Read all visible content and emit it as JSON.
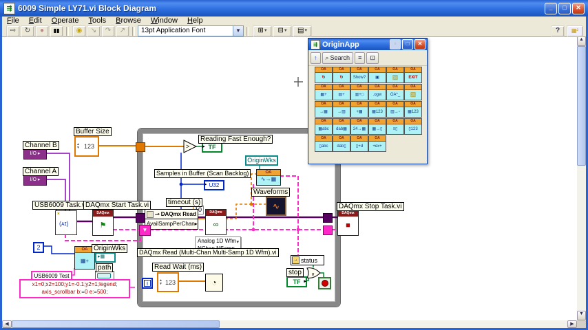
{
  "window": {
    "title": "6009 Simple LY71.vi Block Diagram",
    "minimize": "_",
    "maximize": "□",
    "close": "✕"
  },
  "menu": {
    "items": [
      "File",
      "Edit",
      "Operate",
      "Tools",
      "Browse",
      "Window",
      "Help"
    ]
  },
  "toolbar": {
    "font_selector": "13pt Application Font",
    "help_label": "?"
  },
  "palette": {
    "title": "OriginApp",
    "up_label": "↑",
    "search_label": "Search",
    "rows": [
      [
        {
          "n": "oa-connect-icon",
          "g": "↻",
          "c": "red"
        },
        {
          "n": "oa-reconnect-icon",
          "g": "↻",
          "c": "red"
        },
        {
          "n": "oa-show-icon",
          "g": "Show?"
        },
        {
          "n": "oa-save-icon",
          "g": "▣"
        },
        {
          "n": "oa-open-icon",
          "g": "▨",
          "c": "folder"
        },
        {
          "n": "oa-exit-icon",
          "g": "EXIT",
          "c": "red"
        }
      ],
      [
        {
          "n": "oa-new-worksheet-icon",
          "g": "▦+"
        },
        {
          "n": "oa-new-graph-icon",
          "g": "▤+"
        },
        {
          "n": "oa-new-matrix-icon",
          "g": "▥+□"
        },
        {
          "n": "oa-load-ogw-icon",
          "g": ".ogw"
        },
        {
          "n": "oa-command-icon",
          "g": "OA*_"
        },
        {
          "n": "oa-folder-icon",
          "g": "▨",
          "c": "folder"
        }
      ],
      [
        {
          "n": "oa-put-table-icon",
          "g": "→▦"
        },
        {
          "n": "oa-put-cols-icon",
          "g": "→▥"
        },
        {
          "n": "oa-add-table-icon",
          "g": "+▦"
        },
        {
          "n": "oa-table-123-icon",
          "g": "▦123"
        },
        {
          "n": "oa-col-put-icon",
          "g": "▥→▫"
        },
        {
          "n": "oa-table-num-icon",
          "g": "▦123"
        }
      ],
      [
        {
          "n": "oa-table-abc-icon",
          "g": "▦abc"
        },
        {
          "n": "oa-table-dab-icon",
          "g": "dab▦"
        },
        {
          "n": "oa-table-24-icon",
          "g": "24→▦"
        },
        {
          "n": "oa-table-col-icon",
          "g": "▦→▯"
        },
        {
          "n": "oa-list-col-icon",
          "g": "≡▯"
        },
        {
          "n": "oa-col-123-icon",
          "g": "▯123"
        }
      ],
      [
        {
          "n": "oa-col-abc-icon",
          "g": "▯abc"
        },
        {
          "n": "oa-col-dab-icon",
          "g": "dab▯"
        },
        {
          "n": "oa-col-add-icon",
          "g": "▯+d"
        },
        {
          "n": "oa-col-ex-icon",
          "g": "+ex+"
        }
      ]
    ]
  },
  "diagram": {
    "buffer_size": "Buffer Size",
    "buffer_value": "123",
    "channel_b": "Channel B",
    "channel_a": "Channel A",
    "io_glyph": "I/O",
    "usb_task": "USB6009 Task.vi",
    "start_task": "DAQmx Start Task.vi",
    "stop_task": "DAQmx Stop Task.vi",
    "daq_header": "DAQmx",
    "oa_header": "OA",
    "reading_fast": "Reading Fast Enough?",
    "tf": "TF",
    "samples_label": "Samples in Buffer (Scan Backlog)",
    "samples_type": "U32",
    "timeout_label": "timeout (s)",
    "timeout_value": "10",
    "prop_title": "DAQmx Read",
    "prop_item": "AvailSampPerChan",
    "poly_line1": "Analog 1D Wfm",
    "poly_line2": "NChan NSamp",
    "read_vi_label": "DAQmx Read (Multi-Chan Multi-Samp 1D Wfm).vi",
    "originwks_local": "OriginWks",
    "waveforms": "Waveforms",
    "read_wait": "Read Wait (ms)",
    "read_wait_value": "123",
    "status": "status",
    "stop": "stop",
    "or_glyph": "∨",
    "iter": "i",
    "const2": "2",
    "originwks_ind": "OriginWks",
    "path_label": "path",
    "usb_test": "USB6009 Test",
    "script_line1": "x1=0;x2=100;y1=-0.1;y2=1;legend;",
    "script_line2": "axis_scrollbar b:=0 e:=500;"
  }
}
